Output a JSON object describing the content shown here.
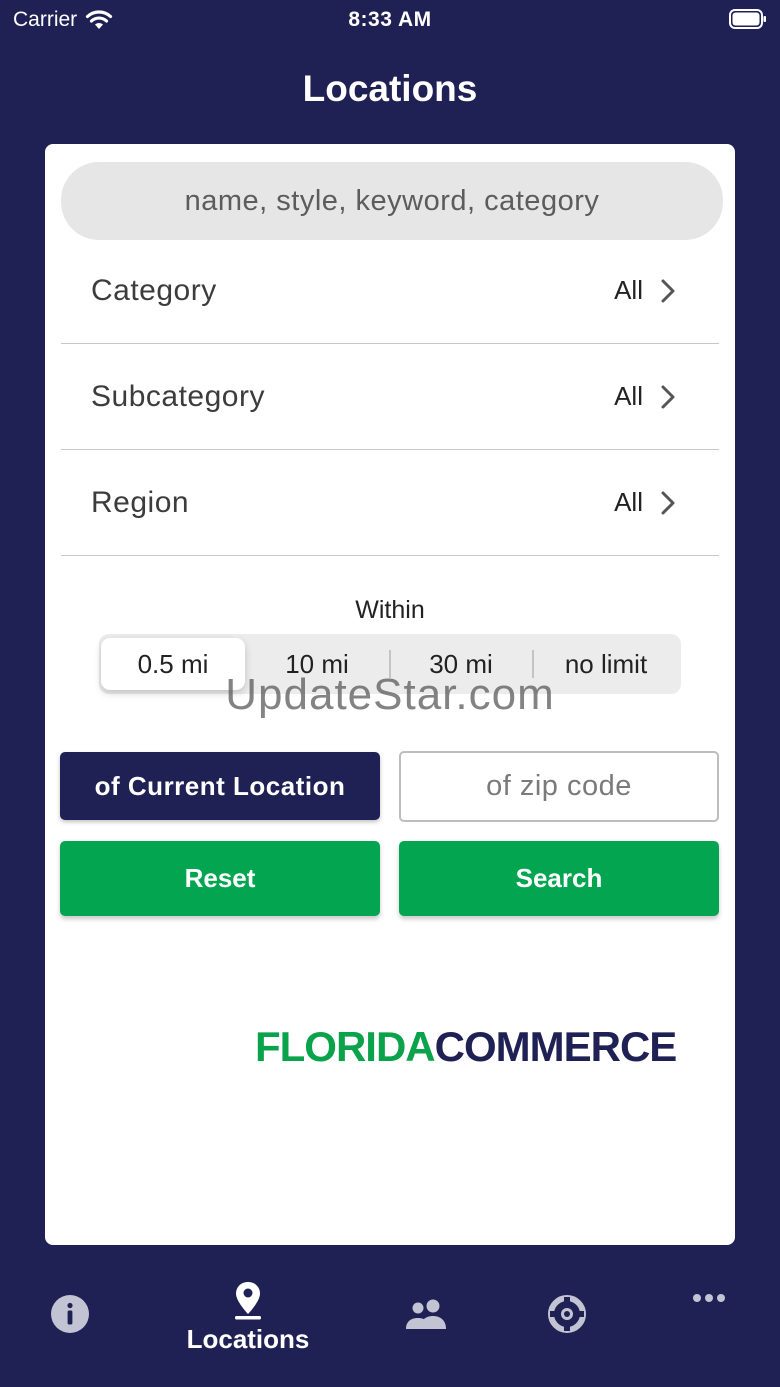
{
  "status_bar": {
    "carrier": "Carrier",
    "time": "8:33 AM"
  },
  "nav": {
    "title": "Locations"
  },
  "search": {
    "placeholder": "name, style, keyword, category"
  },
  "filters": [
    {
      "label": "Category",
      "value": "All"
    },
    {
      "label": "Subcategory",
      "value": "All"
    },
    {
      "label": "Region",
      "value": "All"
    }
  ],
  "distance": {
    "label": "Within",
    "options": [
      "0.5 mi",
      "10 mi",
      "30 mi",
      "no limit"
    ],
    "selected": "0.5 mi"
  },
  "watermark": "UpdateStar.com",
  "location_button": "of Current Location",
  "zip": {
    "placeholder": "of zip code"
  },
  "actions": {
    "reset": "Reset",
    "search": "Search"
  },
  "logo": {
    "part1": "FLORIDA",
    "part2": "COMMERCE"
  },
  "tab_bar": {
    "tabs": [
      {
        "icon": "info-icon",
        "label": ""
      },
      {
        "icon": "location-pin-icon",
        "label": "Locations",
        "active": true
      },
      {
        "icon": "people-icon",
        "label": ""
      },
      {
        "icon": "support-icon",
        "label": ""
      },
      {
        "icon": "more-icon",
        "label": ""
      }
    ]
  },
  "colors": {
    "navy": "#1f2155",
    "green": "#03a551",
    "card": "#ffffff",
    "pill": "#e6e6e6"
  }
}
